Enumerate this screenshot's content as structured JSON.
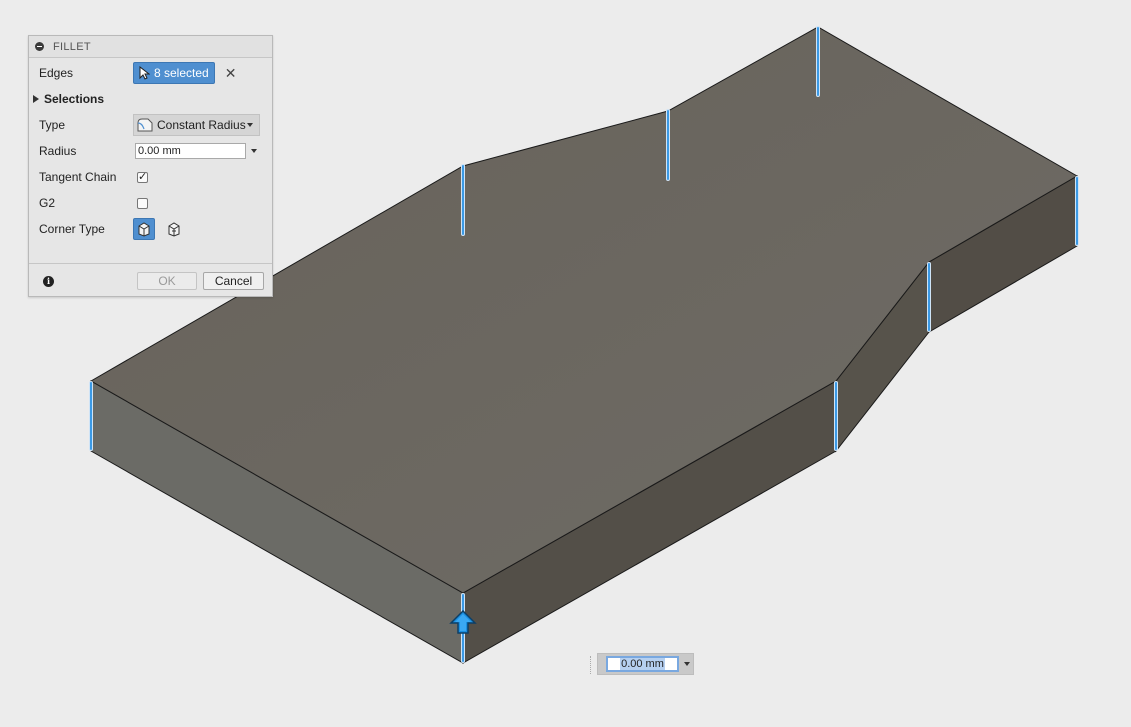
{
  "dialog": {
    "title": "FILLET",
    "edges": {
      "label": "Edges",
      "selection": "8 selected"
    },
    "selections": {
      "label": "Selections"
    },
    "type": {
      "label": "Type",
      "value": "Constant Radius"
    },
    "radius": {
      "label": "Radius",
      "value": "0.00 mm"
    },
    "tangent_chain": {
      "label": "Tangent Chain",
      "checked": true
    },
    "g2": {
      "label": "G2",
      "checked": false
    },
    "corner_type": {
      "label": "Corner Type"
    },
    "ok_label": "OK",
    "cancel_label": "Cancel"
  },
  "viewport": {
    "value_input": "0.00 mm",
    "colors": {
      "top_face": "#6b655b",
      "side_face": "#554f47",
      "edge_highlight": "#4aa3ea",
      "background": "#ececec"
    }
  }
}
